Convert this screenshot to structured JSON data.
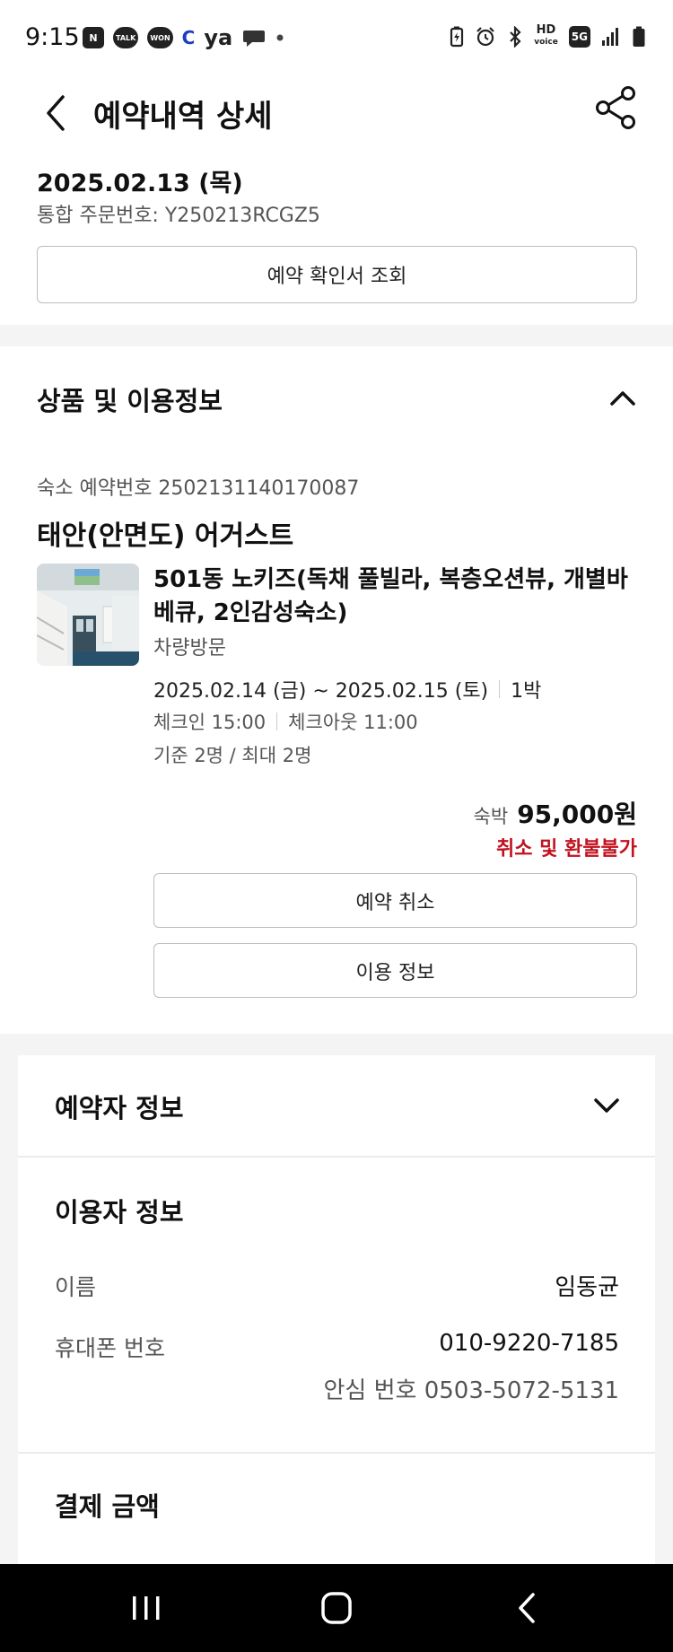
{
  "status_bar": {
    "time": "9:15",
    "left_icons": [
      "naver-icon",
      "kakaotalk-icon",
      "won-icon",
      "c-icon",
      "ya-icon",
      "chat-bubble-icon",
      "dot-icon"
    ],
    "ya_text": "ya",
    "c_text": "C",
    "naver_text": "N",
    "talk_text": "TALK",
    "won_text": "WON",
    "hd_text": "HD",
    "voice_text": "voice",
    "network_text": "5G",
    "right_icons": [
      "battery-saver-icon",
      "alarm-icon",
      "bluetooth-icon",
      "hd-voice-icon",
      "5g-icon",
      "signal-icon",
      "battery-icon"
    ]
  },
  "header": {
    "title": "예약내역 상세",
    "back_icon": "chevron-left-icon",
    "share_icon": "share-icon"
  },
  "summary": {
    "date": "2025.02.13 (목)",
    "order_label": "통합 주문번호: Y250213RCGZ5",
    "confirm_button": "예약 확인서 조회"
  },
  "product_section": {
    "title": "상품 및 이용정보",
    "toggle_icon": "chevron-up-icon",
    "lodging_number": "숙소 예약번호 2502131140170087",
    "hotel_name": "태안(안면도) 어거스트",
    "room_name": "501동 노키즈(독채 풀빌라, 복층오션뷰, 개별바베큐, 2인감성숙소)",
    "visit_type": "차량방문",
    "stay_dates": "2025.02.14 (금) ~ 2025.02.15 (토)",
    "nights": "1박",
    "checkin": "체크인 15:00",
    "checkout": "체크아웃 11:00",
    "capacity": "기준 2명 / 최대 2명",
    "price_label": "숙박",
    "price": "95,000원",
    "refund_policy": "취소 및 환불불가",
    "cancel_button": "예약 취소",
    "usage_button": "이용 정보",
    "accent_color": "#c1121f"
  },
  "booker_section": {
    "title": "예약자 정보",
    "toggle_icon": "chevron-down-icon"
  },
  "user_section": {
    "title": "이용자 정보",
    "name_label": "이름",
    "name_value": "임동균",
    "phone_label": "휴대폰 번호",
    "phone_value": "010-9220-7185",
    "safe_number": "안심 번호 0503-5072-5131"
  },
  "payment_section": {
    "title": "결제 금액"
  },
  "nav_bar": {
    "icons": [
      "recent-apps-icon",
      "home-icon",
      "back-icon"
    ]
  }
}
